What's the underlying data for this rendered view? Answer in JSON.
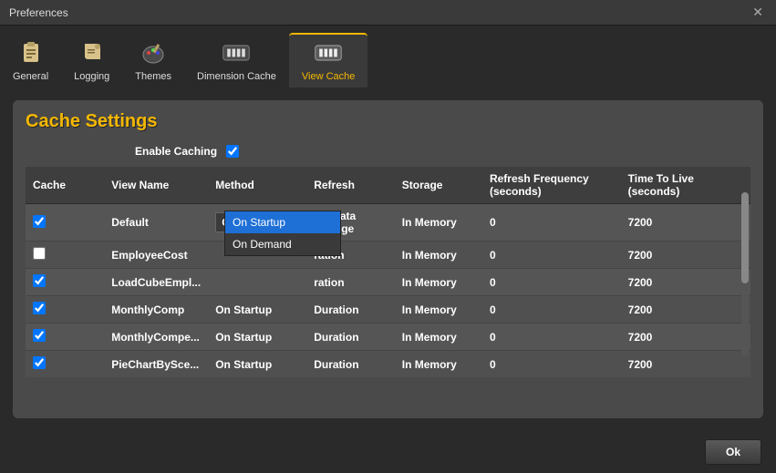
{
  "window": {
    "title": "Preferences"
  },
  "tabs": [
    {
      "label": "General"
    },
    {
      "label": "Logging"
    },
    {
      "label": "Themes"
    },
    {
      "label": "Dimension Cache"
    },
    {
      "label": "View Cache"
    }
  ],
  "section": {
    "title": "Cache Settings"
  },
  "enable": {
    "label": "Enable Caching",
    "checked": true
  },
  "columns": {
    "cache": "Cache",
    "view": "View Name",
    "method": "Method",
    "refresh": "Refresh",
    "storage": "Storage",
    "freq": "Refresh Frequency (seconds)",
    "ttl": "Time To Live (seconds)"
  },
  "rows": [
    {
      "cache": true,
      "view": "Default",
      "method": "On Startup",
      "refresh": "On Data Change",
      "storage": "In Memory",
      "freq": "0",
      "ttl": "7200",
      "open": true
    },
    {
      "cache": false,
      "view": "EmployeeCost",
      "method": "",
      "refresh": "ration",
      "storage": "In Memory",
      "freq": "0",
      "ttl": "7200"
    },
    {
      "cache": true,
      "view": "LoadCubeEmpl...",
      "method": "",
      "refresh": "ration",
      "storage": "In Memory",
      "freq": "0",
      "ttl": "7200"
    },
    {
      "cache": true,
      "view": "MonthlyComp",
      "method": "On Startup",
      "refresh": "Duration",
      "storage": "In Memory",
      "freq": "0",
      "ttl": "7200"
    },
    {
      "cache": true,
      "view": "MonthlyCompe...",
      "method": "On Startup",
      "refresh": "Duration",
      "storage": "In Memory",
      "freq": "0",
      "ttl": "7200"
    },
    {
      "cache": true,
      "view": "PieChartBySce...",
      "method": "On Startup",
      "refresh": "Duration",
      "storage": "In Memory",
      "freq": "0",
      "ttl": "7200"
    }
  ],
  "dropdown": {
    "options": [
      "On Startup",
      "On Demand"
    ],
    "selected": "On Startup"
  },
  "footer": {
    "ok": "Ok"
  }
}
